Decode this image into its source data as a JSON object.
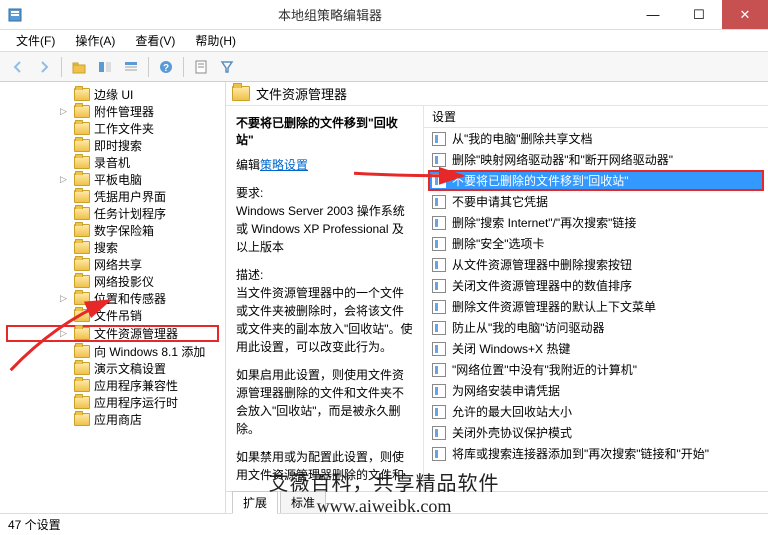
{
  "window": {
    "title": "本地组策略编辑器"
  },
  "menu": {
    "file": "文件(F)",
    "action": "操作(A)",
    "view": "查看(V)",
    "help": "帮助(H)"
  },
  "tree": {
    "items": [
      {
        "label": "边缘 UI",
        "expand": ""
      },
      {
        "label": "附件管理器",
        "expand": "▷"
      },
      {
        "label": "工作文件夹",
        "expand": ""
      },
      {
        "label": "即时搜索",
        "expand": ""
      },
      {
        "label": "录音机",
        "expand": ""
      },
      {
        "label": "平板电脑",
        "expand": "▷"
      },
      {
        "label": "凭据用户界面",
        "expand": ""
      },
      {
        "label": "任务计划程序",
        "expand": ""
      },
      {
        "label": "数字保险箱",
        "expand": ""
      },
      {
        "label": "搜索",
        "expand": ""
      },
      {
        "label": "网络共享",
        "expand": ""
      },
      {
        "label": "网络投影仪",
        "expand": ""
      },
      {
        "label": "位置和传感器",
        "expand": "▷"
      },
      {
        "label": "文件吊销",
        "expand": ""
      },
      {
        "label": "文件资源管理器",
        "expand": "▷",
        "highlight": true
      },
      {
        "label": "向 Windows 8.1 添加",
        "expand": ""
      },
      {
        "label": "演示文稿设置",
        "expand": ""
      },
      {
        "label": "应用程序兼容性",
        "expand": ""
      },
      {
        "label": "应用程序运行时",
        "expand": ""
      },
      {
        "label": "应用商店",
        "expand": ""
      }
    ]
  },
  "header": {
    "title": "文件资源管理器"
  },
  "description": {
    "title": "不要将已删除的文件移到\"回收站\"",
    "edit_prefix": "编辑",
    "edit_link": "策略设置",
    "req_label": "要求:",
    "req_text": "Windows Server 2003 操作系统或 Windows XP Professional 及以上版本",
    "desc_label": "描述:",
    "desc_p1": "当文件资源管理器中的一个文件或文件夹被删除时，会将该文件或文件夹的副本放入\"回收站\"。使用此设置，可以改变此行为。",
    "desc_p2": "如果启用此设置，则使用文件资源管理器删除的文件和文件夹不会放入\"回收站\"，而是被永久删除。",
    "desc_p3": "如果禁用或为配置此设置，则使用文件资源管理器删除的文件和"
  },
  "settings": {
    "column": "设置",
    "items": [
      {
        "label": "从\"我的电脑\"删除共享文档"
      },
      {
        "label": "删除\"映射网络驱动器\"和\"断开网络驱动器\""
      },
      {
        "label": "不要将已删除的文件移到\"回收站\"",
        "selected": true,
        "highlight": true
      },
      {
        "label": "不要申请其它凭据"
      },
      {
        "label": "删除\"搜索 Internet\"/\"再次搜索\"链接"
      },
      {
        "label": "删除\"安全\"选项卡"
      },
      {
        "label": "从文件资源管理器中删除搜索按钮"
      },
      {
        "label": "关闭文件资源管理器中的数值排序"
      },
      {
        "label": "删除文件资源管理器的默认上下文菜单"
      },
      {
        "label": "防止从\"我的电脑\"访问驱动器"
      },
      {
        "label": "关闭 Windows+X 热键"
      },
      {
        "label": "\"网络位置\"中没有\"我附近的计算机\""
      },
      {
        "label": "为网络安装申请凭据"
      },
      {
        "label": "允许的最大回收站大小"
      },
      {
        "label": "关闭外壳协议保护模式"
      },
      {
        "label": "将库或搜索连接器添加到\"再次搜索\"链接和\"开始\""
      }
    ]
  },
  "tabs": {
    "extended": "扩展",
    "standard": "标准"
  },
  "status": {
    "text": "47 个设置"
  },
  "watermark": {
    "line1": "艾薇百科，共享精品软件",
    "line2": "www.aiweibk.com"
  }
}
